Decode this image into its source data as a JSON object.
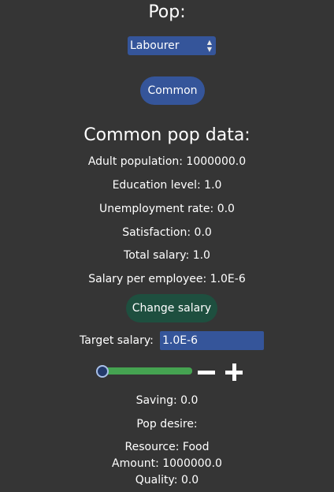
{
  "header": {
    "title": "Pop:"
  },
  "pop_select": {
    "value": "Labourer"
  },
  "common_button": {
    "label": "Common"
  },
  "data_section": {
    "heading": "Common pop data:",
    "adult_population": "Adult population: 1000000.0",
    "education_level": "Education level: 1.0",
    "unemployment_rate": "Unemployment rate: 0.0",
    "satisfaction": "Satisfaction: 0.0",
    "total_salary": "Total salary: 1.0",
    "salary_per_employee": "Salary per employee: 1.0E-6"
  },
  "change_salary_button": {
    "label": "Change salary"
  },
  "target_salary": {
    "label": "Target salary:",
    "value": "1.0E-6"
  },
  "salary_slider": {
    "level": 0.0
  },
  "decrease_icon": "minus-icon",
  "increase_icon": "plus-icon",
  "saving": "Saving: 0.0",
  "pop_desire": {
    "label": "Pop desire:",
    "resource": "Resource: Food",
    "amount": "Amount: 1000000.0",
    "quality": "Quality: 0.0"
  },
  "colors": {
    "background": "#353535",
    "button_blue": "#35559a",
    "button_green": "#1e4f3f",
    "slider_green": "#45a351"
  }
}
